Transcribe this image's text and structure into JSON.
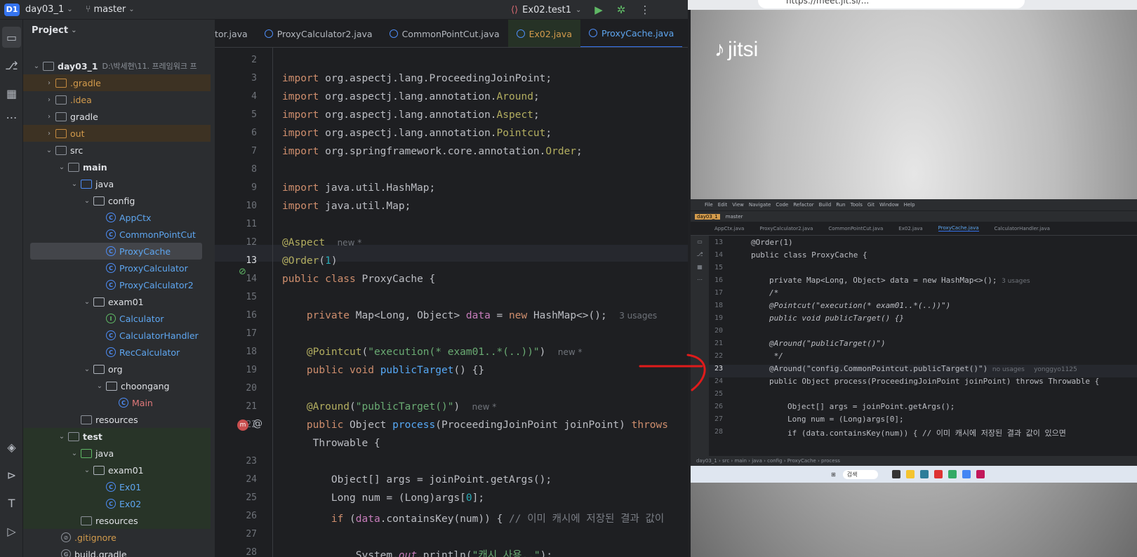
{
  "topbar": {
    "project_badge": "D1",
    "project_name": "day03_1",
    "branch": "master",
    "run_config": "Ex02.test1"
  },
  "panel": {
    "title": "Project",
    "root_name": "day03_1",
    "root_path": "D:\\박세현\\11. 프레임워크 프",
    "tree": [
      {
        "label": ".gradle"
      },
      {
        "label": ".idea"
      },
      {
        "label": "gradle"
      },
      {
        "label": "out"
      },
      {
        "label": "src"
      },
      {
        "label": "main"
      },
      {
        "label": "java"
      },
      {
        "label": "config"
      },
      {
        "label": "AppCtx"
      },
      {
        "label": "CommonPointCut"
      },
      {
        "label": "ProxyCache"
      },
      {
        "label": "ProxyCalculator"
      },
      {
        "label": "ProxyCalculator2"
      },
      {
        "label": "exam01"
      },
      {
        "label": "Calculator"
      },
      {
        "label": "CalculatorHandler"
      },
      {
        "label": "RecCalculator"
      },
      {
        "label": "org"
      },
      {
        "label": "choongang"
      },
      {
        "label": "Main"
      },
      {
        "label": "resources"
      },
      {
        "label": "test"
      },
      {
        "label": "java"
      },
      {
        "label": "exam01"
      },
      {
        "label": "Ex01"
      },
      {
        "label": "Ex02"
      },
      {
        "label": "resources"
      },
      {
        "label": ".gitignore"
      },
      {
        "label": "build.gradle"
      }
    ]
  },
  "editor": {
    "tabs": [
      {
        "label": "tor.java"
      },
      {
        "label": "ProxyCalculator2.java"
      },
      {
        "label": "CommonPointCut.java"
      },
      {
        "label": "Ex02.java"
      },
      {
        "label": "ProxyCache.java"
      }
    ],
    "line_numbers": [
      "2",
      "3",
      "4",
      "5",
      "6",
      "7",
      "8",
      "9",
      "10",
      "11",
      "12",
      "13",
      "14",
      "15",
      "16",
      "17",
      "18",
      "19",
      "20",
      "21",
      "22",
      "",
      "23",
      "24",
      "25",
      "26",
      "27",
      "28"
    ],
    "lines": {
      "l3_kw": "import ",
      "l3_rest": "org.aspectj.lang.ProceedingJoinPoint;",
      "l4_kw": "import ",
      "l4_rest": "org.aspectj.lang.annotation.",
      "l4_an": "Around",
      "l4_end": ";",
      "l5_kw": "import ",
      "l5_rest": "org.aspectj.lang.annotation.",
      "l5_an": "Aspect",
      "l5_end": ";",
      "l6_kw": "import ",
      "l6_rest": "org.aspectj.lang.annotation.",
      "l6_an": "Pointcut",
      "l6_end": ";",
      "l7_kw": "import ",
      "l7_rest": "org.springframework.core.annotation.",
      "l7_an": "Order",
      "l7_end": ";",
      "l9_kw": "import ",
      "l9_rest": "java.util.HashMap;",
      "l10_kw": "import ",
      "l10_rest": "java.util.Map;",
      "l12_an": "@Aspect",
      "l12_hint": "new *",
      "l13_an": "@Order",
      "l13_p1": "(",
      "l13_num": "1",
      "l13_p2": ")",
      "l14_kw": "public class ",
      "l14_rest": "ProxyCache {",
      "l16_kw": "private ",
      "l16_t": "Map<Long, Object> ",
      "l16_fld": "data",
      "l16_eq": " = ",
      "l16_kw2": "new ",
      "l16_rest": "HashMap<>();",
      "l16_hint": "3 usages",
      "l18_an": "@Pointcut",
      "l18_p": "(",
      "l18_str": "\"execution(* exam01..*(..))\"",
      "l18_end": ")",
      "l18_hint": "new *",
      "l19_kw": "public void ",
      "l19_fn": "publicTarget",
      "l19_rest": "() {}",
      "l21_an": "@Around",
      "l21_p": "(",
      "l21_str": "\"publicTarget()\"",
      "l21_end": ")",
      "l21_hint": "new *",
      "l22_kw": "public ",
      "l22_t": "Object ",
      "l22_fn": "process",
      "l22_rest": "(ProceedingJoinPoint joinPoint) ",
      "l22_kw2": "throws",
      "l22b_rest": "Throwable {",
      "l24_rest": "Object[] args = joinPoint.getArgs();",
      "l25_rest": "Long num = (Long)args[",
      "l25_num": "0",
      "l25_end": "];",
      "l26_kw": "if ",
      "l26_p": "(",
      "l26_fld": "data",
      "l26_rest": ".containsKey(num)) { ",
      "l26_cmt": "// 이미 캐시에 저장된 결과 값이",
      "l28_rest": "System.",
      "l28_fld": "out",
      "l28_rest2": ".println(",
      "l28_str": "\"캐시 사용..\"",
      "l28_end": ");"
    }
  },
  "browser": {
    "url": "https://meet.jit.si/...",
    "logo_text": "jitsi",
    "shared_screen": {
      "menu": [
        "File",
        "Edit",
        "View",
        "Navigate",
        "Code",
        "Refactor",
        "Build",
        "Run",
        "Tools",
        "Git",
        "Window",
        "Help"
      ],
      "project": "day03_1",
      "branch": "master",
      "tabs": [
        "AppCtx.java",
        "ProxyCalculator2.java",
        "CommonPointCut.java",
        "Ex02.java",
        "ProxyCache.java",
        "CalculatorHandler.java"
      ],
      "line_numbers": [
        "13",
        "14",
        "15",
        "16",
        "17",
        "18",
        "19",
        "20",
        "21",
        "22",
        "23",
        "24",
        "25",
        "26",
        "27",
        "28"
      ],
      "lines": {
        "s13": "@Order(1)",
        "s14": "public class ProxyCache {",
        "s16a": "private Map<Long, Object> data = new HashMap<>();",
        "s16_hint": "3 usages",
        "s17": "/*",
        "s18": "@Pointcut(\"execution(* exam01..*(..))\")",
        "s19": "public void publicTarget() {}",
        "s21": "@Around(\"publicTarget()\")",
        "s22": " */",
        "s23": "@Around(\"config.CommonPointcut.publicTarget()\")",
        "s23_hint1": "no usages",
        "s23_hint2": "yonggyo1125",
        "s24": "public Object process(ProceedingJoinPoint joinPoint) throws Throwable {",
        "s26": "Object[] args = joinPoint.getArgs();",
        "s27": "Long num = (Long)args[0];",
        "s28": "if (data.containsKey(num)) { // 이미 캐시에 저장된 결과 값이 있으면"
      },
      "status": "day03_1 › src › main › java › config › ProxyCache › process",
      "taskbar_search": "검색"
    }
  },
  "colors": {
    "accent": "#3574f0",
    "annotation_arrow": "#e01b1b"
  }
}
